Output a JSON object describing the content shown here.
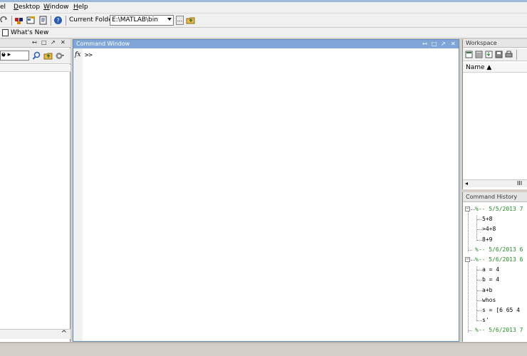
{
  "menu": {
    "items": [
      "el",
      "Desktop",
      "Window",
      "Help"
    ],
    "underline": [
      "",
      "D",
      "W",
      "H"
    ]
  },
  "toolbar": {
    "current_folder_label": "Current Folder:",
    "current_folder_value": "E:\\MATLAB\\bin",
    "browse_label": "..."
  },
  "shortcuts": {
    "whats_new": "What's New"
  },
  "left_panel": {
    "combo_value": "n ▸",
    "controls": [
      "↤",
      "□",
      "↗",
      "✕"
    ],
    "scroll_up": "^"
  },
  "command_window": {
    "title": "Command Window",
    "fx": "fx",
    "prompt": ">>",
    "controls": [
      "↤",
      "□",
      "↗",
      "✕"
    ]
  },
  "workspace": {
    "title": "Workspace",
    "name_header": "Name ▲",
    "hscroll_left": "◂",
    "hscroll_mid": "III"
  },
  "command_history": {
    "title": "Command History",
    "entries": [
      {
        "type": "session",
        "text": "%-- 5/5/2013 7",
        "box": "−"
      },
      {
        "type": "cmd",
        "text": "5+8"
      },
      {
        "type": "cmd",
        "text": ">4+8"
      },
      {
        "type": "cmd",
        "text": "8+9"
      },
      {
        "type": "session",
        "text": "%-- 5/6/2013 6"
      },
      {
        "type": "session",
        "text": "%-- 5/6/2013 6",
        "box": "−"
      },
      {
        "type": "cmd",
        "text": "a = 4"
      },
      {
        "type": "cmd",
        "text": "b = 4"
      },
      {
        "type": "cmd",
        "text": "a+b"
      },
      {
        "type": "cmd",
        "text": "whos"
      },
      {
        "type": "cmd",
        "text": "s = [6 65 4"
      },
      {
        "type": "cmd",
        "text": "s'"
      },
      {
        "type": "session",
        "text": "%-- 5/6/2013 7"
      }
    ]
  },
  "colors": {
    "command_title_bar": "#7fa6d6",
    "session_text": "#228b22",
    "chrome": "#f0f0f0"
  }
}
